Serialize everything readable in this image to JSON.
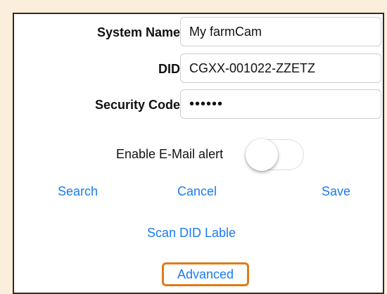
{
  "form": {
    "system_name": {
      "label": "System Name:",
      "value": "My farmCam"
    },
    "did": {
      "label": "DID:",
      "value": "CGXX-001022-ZZETZ"
    },
    "security_code": {
      "label": "Security Code:",
      "value": "••••••"
    },
    "email_alert": {
      "label": "Enable E-Mail alert",
      "enabled": false
    }
  },
  "actions": {
    "search": "Search",
    "cancel": "Cancel",
    "save": "Save",
    "scan_did": "Scan DID Lable",
    "advanced": "Advanced"
  },
  "colors": {
    "accent_link": "#1a7cf2",
    "highlight_border": "#e07b1a",
    "page_background": "#fbeedd"
  }
}
